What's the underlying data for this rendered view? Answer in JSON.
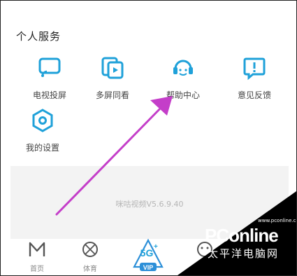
{
  "section": {
    "title": "个人服务"
  },
  "services": [
    {
      "label": "电视投屏",
      "icon": "tv-cast-icon"
    },
    {
      "label": "多屏同看",
      "icon": "multi-screen-icon"
    },
    {
      "label": "帮助中心",
      "icon": "headset-icon"
    },
    {
      "label": "意见反馈",
      "icon": "feedback-icon"
    },
    {
      "label": "我的设置",
      "icon": "hexagon-settings-icon"
    }
  ],
  "version": "咪咕视频V5.6.9.40",
  "tabs": [
    {
      "label": "首页",
      "icon": "home-m-icon"
    },
    {
      "label": "体育",
      "icon": "ball-icon"
    },
    {
      "label": "VIP",
      "badge": "5G",
      "icon": "5g-vip-icon"
    },
    {
      "label": "",
      "icon": "face-icon"
    }
  ],
  "watermark": {
    "brand": "PConline",
    "sub": "太平洋电脑网",
    "domain": "www.pconline.com.cn"
  },
  "colors": {
    "accent": "#1fa1d9",
    "annotation": "#c43ec9"
  }
}
